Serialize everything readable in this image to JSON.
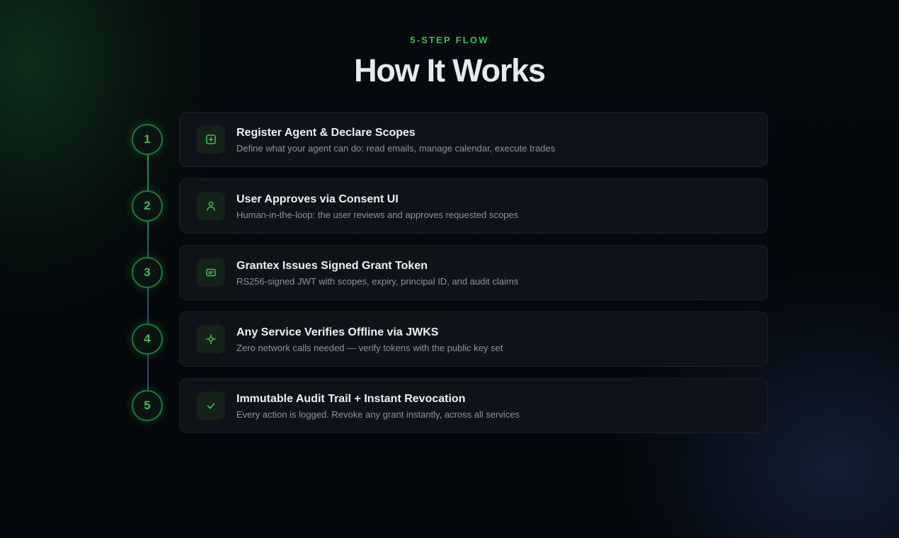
{
  "section": {
    "eyebrow": "5-STEP FLOW",
    "title": "How It Works"
  },
  "colors": {
    "accent": "#3fbf57",
    "background": "#05080d",
    "card": "#11141b",
    "title_text": "#e8eaee",
    "muted_text": "#8b93a0"
  },
  "steps": [
    {
      "number": "1",
      "title": "Register Agent & Declare Scopes",
      "description": "Define what your agent can do: read emails, manage calendar, execute trades",
      "icon": "plus-square-icon"
    },
    {
      "number": "2",
      "title": "User Approves via Consent UI",
      "description": "Human-in-the-loop: the user reviews and approves requested scopes",
      "icon": "user-icon"
    },
    {
      "number": "3",
      "title": "Grantex Issues Signed Grant Token",
      "description": "RS256-signed JWT with scopes, expiry, principal ID, and audit claims",
      "icon": "token-card-icon"
    },
    {
      "number": "4",
      "title": "Any Service Verifies Offline via JWKS",
      "description": "Zero network calls needed — verify tokens with the public key set",
      "icon": "crosshair-icon"
    },
    {
      "number": "5",
      "title": "Immutable Audit Trail + Instant Revocation",
      "description": "Every action is logged. Revoke any grant instantly, across all services",
      "icon": "check-icon"
    }
  ]
}
